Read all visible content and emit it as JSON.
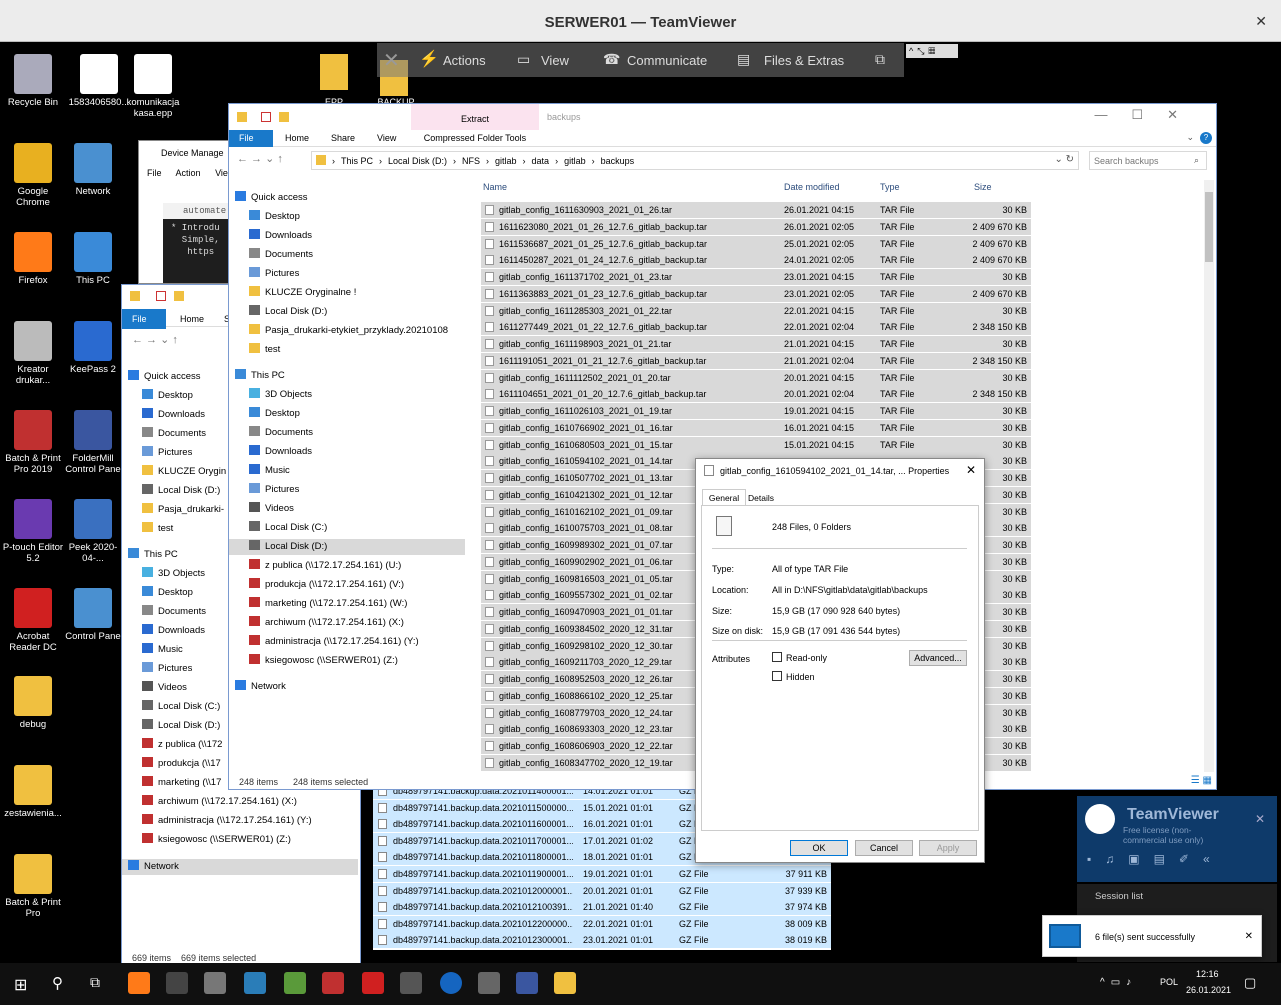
{
  "teamviewer": {
    "title": "SERWER01 — TeamViewer",
    "close": "✕",
    "toolbar": [
      "Actions",
      "View",
      "Communicate",
      "Files & Extras"
    ],
    "panel": {
      "brand": "TeamViewer",
      "license": "Free license (non-commercial use only)",
      "session": "Session list"
    },
    "toast": "6 file(s) sent successfully"
  },
  "desktop_icons": [
    {
      "label": "Recycle Bin"
    },
    {
      "label": "1583406580..."
    },
    {
      "label": "komunikacja kasa.epp"
    },
    {
      "label": "Google Chrome"
    },
    {
      "label": "Network"
    },
    {
      "label": "Firefox"
    },
    {
      "label": "This PC"
    },
    {
      "label": "Kreator drukar..."
    },
    {
      "label": "KeePass 2"
    },
    {
      "label": "Batch & Print Pro 2019"
    },
    {
      "label": "FolderMill Control Pane"
    },
    {
      "label": "P-touch Editor 5.2"
    },
    {
      "label": "Peek 2020-04-..."
    },
    {
      "label": "Acrobat Reader DC"
    },
    {
      "label": "Control Pane"
    },
    {
      "label": "debug"
    },
    {
      "label": "zestawienia..."
    },
    {
      "label": "Batch & Print Pro"
    },
    {
      "label": "EPP"
    },
    {
      "label": "BACKUP"
    }
  ],
  "devmgr": {
    "title": "Device Manage",
    "menu": [
      "File",
      "Action",
      "Vie"
    ],
    "auto": "automate",
    "code": [
      "* Introdu",
      "  Simple,",
      "",
      "   https"
    ]
  },
  "explorer_main": {
    "tab_extract": "Extract",
    "title": "backups",
    "tabs": [
      "File",
      "Home",
      "Share",
      "View",
      "Compressed Folder Tools"
    ],
    "breadcrumb": [
      "This PC",
      "Local Disk (D:)",
      "NFS",
      "gitlab",
      "data",
      "gitlab",
      "backups"
    ],
    "search_placeholder": "Search backups",
    "nav": [
      "Quick access",
      "Desktop",
      "Downloads",
      "Documents",
      "Pictures",
      "KLUCZE Oryginalne !",
      "Local Disk (D:)",
      "Pasja_drukarki-etykiet_przyklady.20210108",
      "test",
      "This PC",
      "3D Objects",
      "Desktop",
      "Documents",
      "Downloads",
      "Music",
      "Pictures",
      "Videos",
      "Local Disk (C:)",
      "Local Disk (D:)",
      "z publica (\\\\172.17.254.161) (U:)",
      "produkcja (\\\\172.17.254.161) (V:)",
      "marketing (\\\\172.17.254.161) (W:)",
      "archiwum (\\\\172.17.254.161) (X:)",
      "administracja (\\\\172.17.254.161) (Y:)",
      "ksiegowosc (\\\\SERWER01) (Z:)",
      "Network"
    ],
    "columns": [
      "Name",
      "Date modified",
      "Type",
      "Size"
    ],
    "rows": [
      [
        "gitlab_config_1611630903_2021_01_26.tar",
        "26.01.2021 04:15",
        "TAR File",
        "30 KB"
      ],
      [
        "1611623080_2021_01_26_12.7.6_gitlab_backup.tar",
        "26.01.2021 02:05",
        "TAR File",
        "2 409 670 KB"
      ],
      [
        "1611536687_2021_01_25_12.7.6_gitlab_backup.tar",
        "25.01.2021 02:05",
        "TAR File",
        "2 409 670 KB"
      ],
      [
        "1611450287_2021_01_24_12.7.6_gitlab_backup.tar",
        "24.01.2021 02:05",
        "TAR File",
        "2 409 670 KB"
      ],
      [
        "gitlab_config_1611371702_2021_01_23.tar",
        "23.01.2021 04:15",
        "TAR File",
        "30 KB"
      ],
      [
        "1611363883_2021_01_23_12.7.6_gitlab_backup.tar",
        "23.01.2021 02:05",
        "TAR File",
        "2 409 670 KB"
      ],
      [
        "gitlab_config_1611285303_2021_01_22.tar",
        "22.01.2021 04:15",
        "TAR File",
        "30 KB"
      ],
      [
        "1611277449_2021_01_22_12.7.6_gitlab_backup.tar",
        "22.01.2021 02:04",
        "TAR File",
        "2 348 150 KB"
      ],
      [
        "gitlab_config_1611198903_2021_01_21.tar",
        "21.01.2021 04:15",
        "TAR File",
        "30 KB"
      ],
      [
        "1611191051_2021_01_21_12.7.6_gitlab_backup.tar",
        "21.01.2021 02:04",
        "TAR File",
        "2 348 150 KB"
      ],
      [
        "gitlab_config_1611112502_2021_01_20.tar",
        "20.01.2021 04:15",
        "TAR File",
        "30 KB"
      ],
      [
        "1611104651_2021_01_20_12.7.6_gitlab_backup.tar",
        "20.01.2021 02:04",
        "TAR File",
        "2 348 150 KB"
      ],
      [
        "gitlab_config_1611026103_2021_01_19.tar",
        "19.01.2021 04:15",
        "TAR File",
        "30 KB"
      ],
      [
        "gitlab_config_1610766902_2021_01_16.tar",
        "16.01.2021 04:15",
        "TAR File",
        "30 KB"
      ],
      [
        "gitlab_config_1610680503_2021_01_15.tar",
        "15.01.2021 04:15",
        "TAR File",
        "30 KB"
      ],
      [
        "gitlab_config_1610594102_2021_01_14.tar",
        "",
        "",
        "30 KB"
      ],
      [
        "gitlab_config_1610507702_2021_01_13.tar",
        "",
        "",
        "30 KB"
      ],
      [
        "gitlab_config_1610421302_2021_01_12.tar",
        "",
        "",
        "30 KB"
      ],
      [
        "gitlab_config_1610162102_2021_01_09.tar",
        "",
        "",
        "30 KB"
      ],
      [
        "gitlab_config_1610075703_2021_01_08.tar",
        "",
        "",
        "30 KB"
      ],
      [
        "gitlab_config_1609989302_2021_01_07.tar",
        "",
        "",
        "30 KB"
      ],
      [
        "gitlab_config_1609902902_2021_01_06.tar",
        "",
        "",
        "30 KB"
      ],
      [
        "gitlab_config_1609816503_2021_01_05.tar",
        "",
        "",
        "30 KB"
      ],
      [
        "gitlab_config_1609557302_2021_01_02.tar",
        "",
        "",
        "30 KB"
      ],
      [
        "gitlab_config_1609470903_2021_01_01.tar",
        "",
        "",
        "30 KB"
      ],
      [
        "gitlab_config_1609384502_2020_12_31.tar",
        "",
        "",
        "30 KB"
      ],
      [
        "gitlab_config_1609298102_2020_12_30.tar",
        "",
        "",
        "30 KB"
      ],
      [
        "gitlab_config_1609211703_2020_12_29.tar",
        "",
        "",
        "30 KB"
      ],
      [
        "gitlab_config_1608952503_2020_12_26.tar",
        "",
        "",
        "30 KB"
      ],
      [
        "gitlab_config_1608866102_2020_12_25.tar",
        "",
        "",
        "30 KB"
      ],
      [
        "gitlab_config_1608779703_2020_12_24.tar",
        "",
        "",
        "30 KB"
      ],
      [
        "gitlab_config_1608693303_2020_12_23.tar",
        "",
        "",
        "30 KB"
      ],
      [
        "gitlab_config_1608606903_2020_12_22.tar",
        "",
        "",
        "30 KB"
      ],
      [
        "gitlab_config_1608347702_2020_12_19.tar",
        "",
        "",
        "30 KB"
      ]
    ],
    "status_items": "248 items",
    "status_selected": "248 items selected"
  },
  "explorer_back": {
    "tabs": [
      "File",
      "Home",
      "S"
    ],
    "nav": [
      "Quick access",
      "Desktop",
      "Downloads",
      "Documents",
      "Pictures",
      "KLUCZE Orygin",
      "Local Disk (D:)",
      "Pasja_drukarki-",
      "test",
      "This PC",
      "3D Objects",
      "Desktop",
      "Documents",
      "Downloads",
      "Music",
      "Pictures",
      "Videos",
      "Local Disk (C:)",
      "Local Disk (D:)",
      "z publica (\\\\172",
      "produkcja (\\\\17",
      "marketing (\\\\17",
      "archiwum (\\\\172.17.254.161) (X:)",
      "administracja (\\\\172.17.254.161) (Y:)",
      "ksiegowosc (\\\\SERWER01) (Z:)",
      "Network"
    ],
    "rows": [
      [
        "db489797141.backup.data.2021011400001...",
        "14.01.2021 01:01",
        "GZ File",
        ""
      ],
      [
        "db489797141.backup.data.2021011500000...",
        "15.01.2021 01:01",
        "GZ File",
        ""
      ],
      [
        "db489797141.backup.data.2021011600001...",
        "16.01.2021 01:01",
        "GZ File",
        ""
      ],
      [
        "db489797141.backup.data.2021011700001...",
        "17.01.2021 01:02",
        "GZ File",
        ""
      ],
      [
        "db489797141.backup.data.2021011800001...",
        "18.01.2021 01:01",
        "GZ File",
        ""
      ],
      [
        "db489797141.backup.data.2021011900001...",
        "19.01.2021 01:01",
        "GZ File",
        "37 911 KB"
      ],
      [
        "db489797141.backup.data.2021012000001...",
        "20.01.2021 01:01",
        "GZ File",
        "37 939 KB"
      ],
      [
        "db489797141.backup.data.2021012100391...",
        "21.01.2021 01:40",
        "GZ File",
        "37 974 KB"
      ],
      [
        "db489797141.backup.data.2021012200000...",
        "22.01.2021 01:01",
        "GZ File",
        "38 009 KB"
      ],
      [
        "db489797141.backup.data.2021012300001...",
        "23.01.2021 01:01",
        "GZ File",
        "38 019 KB"
      ]
    ],
    "status_items": "669 items",
    "status_selected": "669 items selected"
  },
  "properties": {
    "title": "gitlab_config_1610594102_2021_01_14.tar, ... Properties",
    "tabs": [
      "General",
      "Details"
    ],
    "summary": "248 Files, 0 Folders",
    "fields": [
      {
        "label": "Type:",
        "value": "All of type TAR File"
      },
      {
        "label": "Location:",
        "value": "All in D:\\NFS\\gitlab\\data\\gitlab\\backups"
      },
      {
        "label": "Size:",
        "value": "15,9 GB (17 090 928 640 bytes)"
      },
      {
        "label": "Size on disk:",
        "value": "15,9 GB (17 091 436 544 bytes)"
      }
    ],
    "attributes_label": "Attributes",
    "readonly": "Read-only",
    "hidden": "Hidden",
    "advanced": "Advanced...",
    "ok": "OK",
    "cancel": "Cancel",
    "apply": "Apply"
  },
  "taskbar": {
    "lang": "POL",
    "time": "12:16",
    "date": "26.01.2021"
  },
  "colors": {
    "accent": "#0078d7",
    "selection": "#cce8ff",
    "selection_inactive": "#d9d9d9",
    "tv_blue": "#0e3a6a"
  }
}
